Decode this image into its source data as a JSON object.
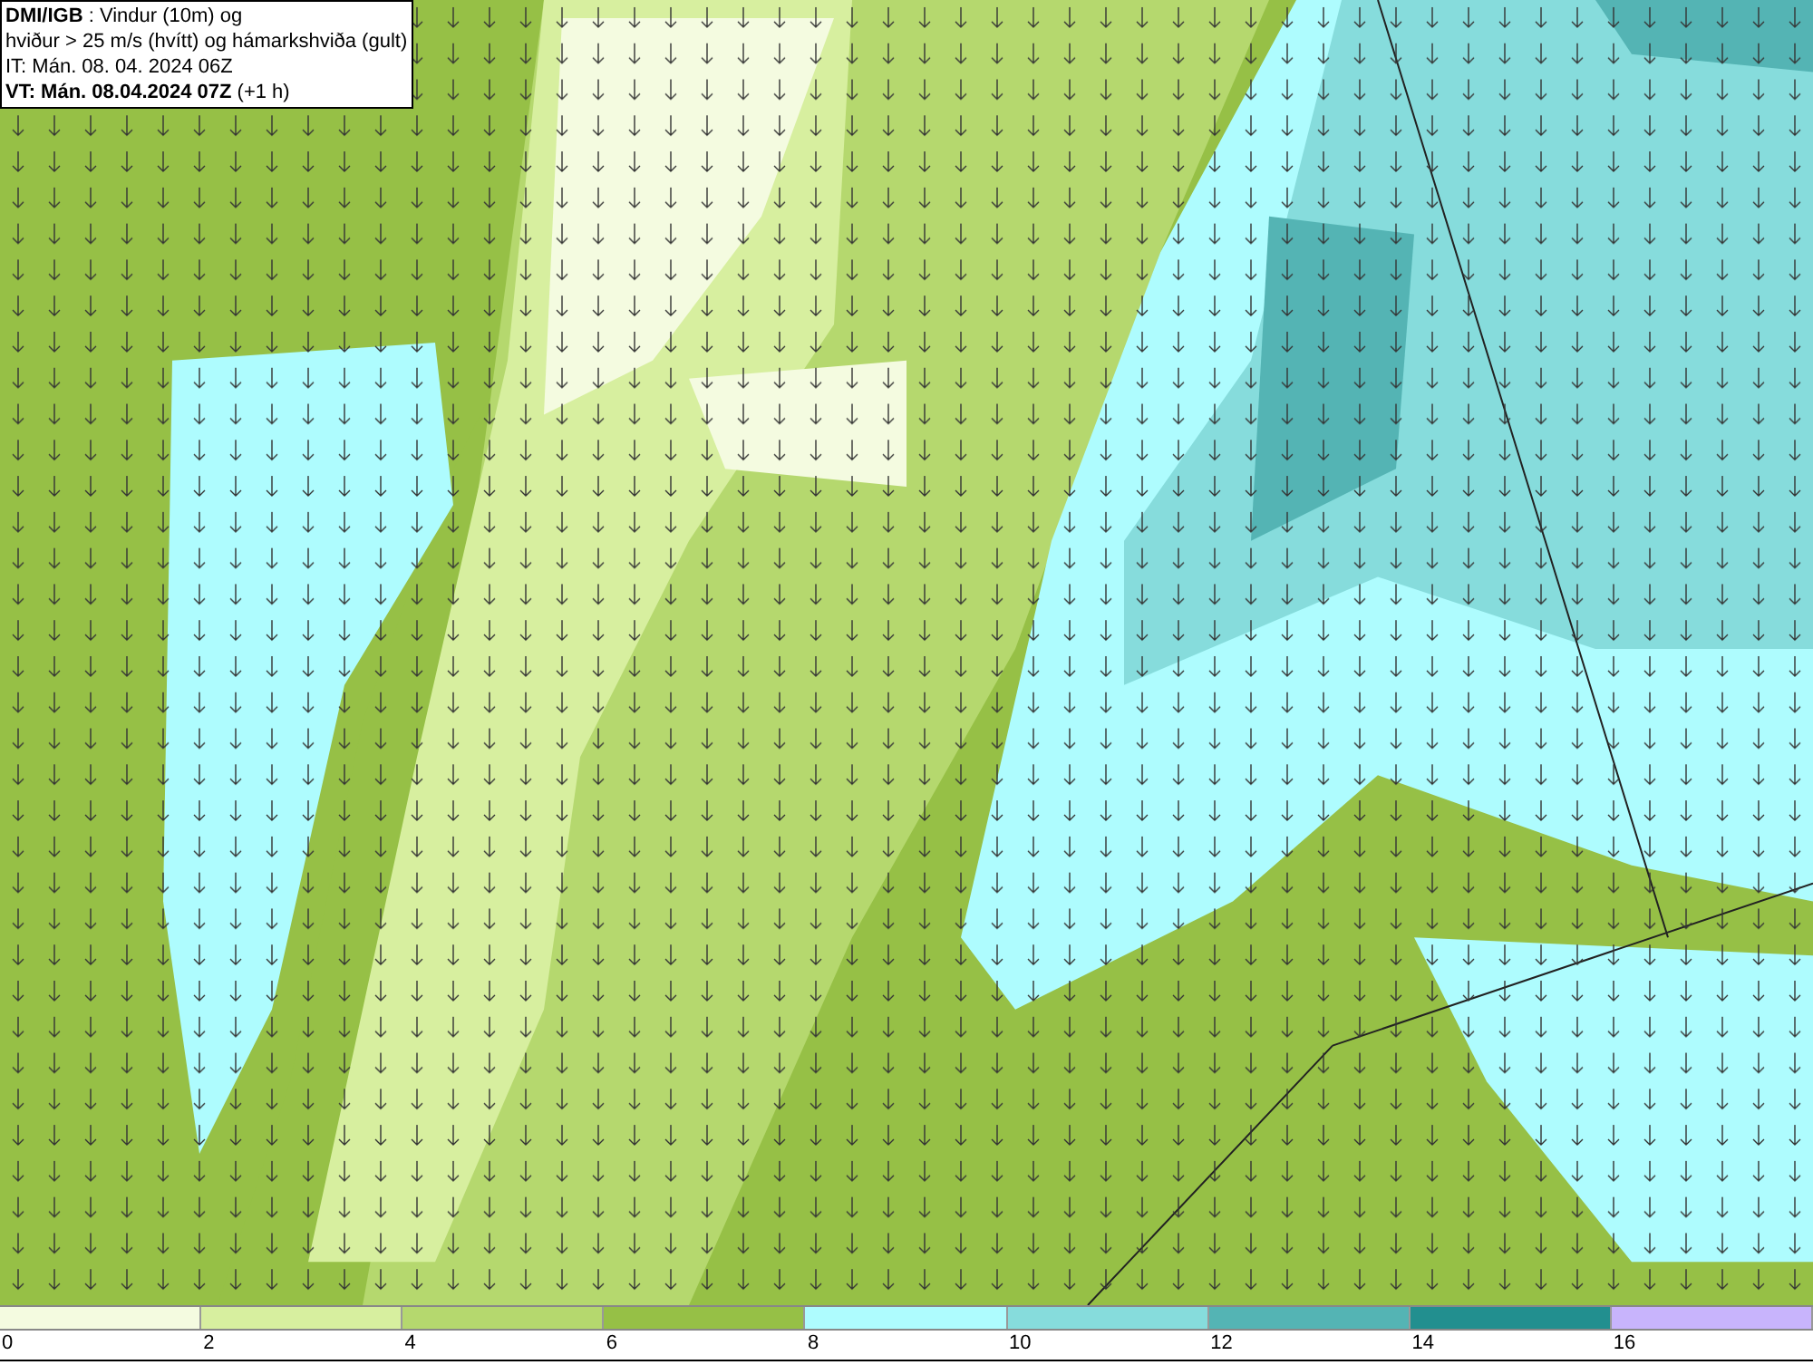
{
  "title_box": {
    "lines": [
      "**DMI/IGB** : Vindur (10m) og",
      "hviður > 25 m/s (hvítt) og hámarkshviða (gult)",
      "IT: Mán. 08. 04. 2024 06Z",
      "**VT: Mán. 08.04.2024 07Z** (+1 h)"
    ]
  },
  "legend": [
    {
      "label": "0",
      "color": "#f4fbe0"
    },
    {
      "label": "2",
      "color": "#d7ef9f"
    },
    {
      "label": "4",
      "color": "#b5d86e"
    },
    {
      "label": "6",
      "color": "#96c046"
    },
    {
      "label": "8",
      "color": "#aefcfe"
    },
    {
      "label": "10",
      "color": "#86dcdc"
    },
    {
      "label": "12",
      "color": "#54b4b4"
    },
    {
      "label": "14",
      "color": "#228f8f"
    },
    {
      "label": "16",
      "color": "#c8b4fc"
    }
  ]
}
